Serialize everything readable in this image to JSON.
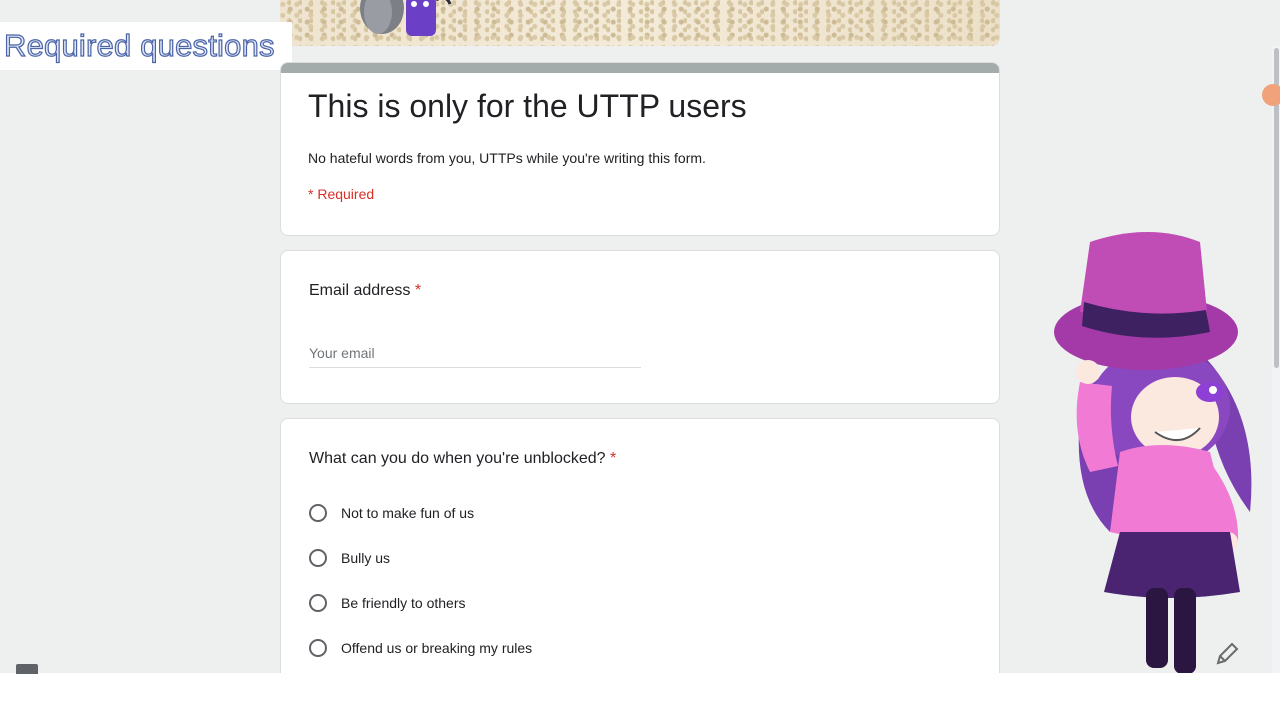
{
  "overlay": {
    "title": "Required questions"
  },
  "form": {
    "title": "This is only for the UTTP users",
    "description": "No hateful words from you, UTTPs  while you're writing this form.",
    "required_note": "* Required"
  },
  "email_question": {
    "label": "Email address",
    "required_mark": "*",
    "placeholder": "Your email",
    "value": ""
  },
  "choice_question": {
    "label": "What can you do when you're unblocked?",
    "required_mark": "*",
    "options": [
      {
        "label": "Not to make fun of us"
      },
      {
        "label": "Bully us"
      },
      {
        "label": "Be friendly to others"
      },
      {
        "label": "Offend us or breaking my rules"
      }
    ]
  },
  "icons": {
    "edit": "pencil-icon"
  },
  "colors": {
    "required": "#d93025",
    "header_bar": "#a3acab",
    "overlay_text": "#4b64a6"
  }
}
